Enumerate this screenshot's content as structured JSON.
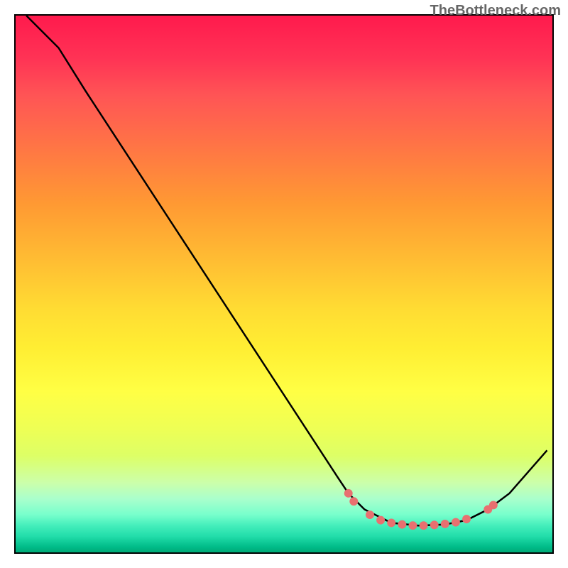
{
  "watermark": "TheBottleneck.com",
  "chart_data": {
    "type": "line",
    "title": "",
    "xlabel": "",
    "ylabel": "",
    "xlim": [
      0,
      100
    ],
    "ylim": [
      0,
      100
    ],
    "series": [
      {
        "name": "curve",
        "points": [
          {
            "x": 2,
            "y": 100
          },
          {
            "x": 8,
            "y": 94
          },
          {
            "x": 13,
            "y": 86
          },
          {
            "x": 60,
            "y": 14
          },
          {
            "x": 62,
            "y": 11
          },
          {
            "x": 65,
            "y": 8
          },
          {
            "x": 70,
            "y": 5.5
          },
          {
            "x": 75,
            "y": 5
          },
          {
            "x": 80,
            "y": 5.2
          },
          {
            "x": 84,
            "y": 6
          },
          {
            "x": 88,
            "y": 8
          },
          {
            "x": 92,
            "y": 11
          },
          {
            "x": 99,
            "y": 19
          }
        ]
      },
      {
        "name": "markers",
        "points": [
          {
            "x": 62,
            "y": 11
          },
          {
            "x": 63,
            "y": 9.5
          },
          {
            "x": 66,
            "y": 7
          },
          {
            "x": 68,
            "y": 6
          },
          {
            "x": 70,
            "y": 5.5
          },
          {
            "x": 72,
            "y": 5.2
          },
          {
            "x": 74,
            "y": 5
          },
          {
            "x": 76,
            "y": 5
          },
          {
            "x": 78,
            "y": 5.1
          },
          {
            "x": 80,
            "y": 5.3
          },
          {
            "x": 82,
            "y": 5.6
          },
          {
            "x": 84,
            "y": 6.2
          },
          {
            "x": 88,
            "y": 8
          },
          {
            "x": 89,
            "y": 8.8
          }
        ]
      }
    ],
    "colors": {
      "curve": "#000000",
      "markers": "#e87070"
    }
  }
}
